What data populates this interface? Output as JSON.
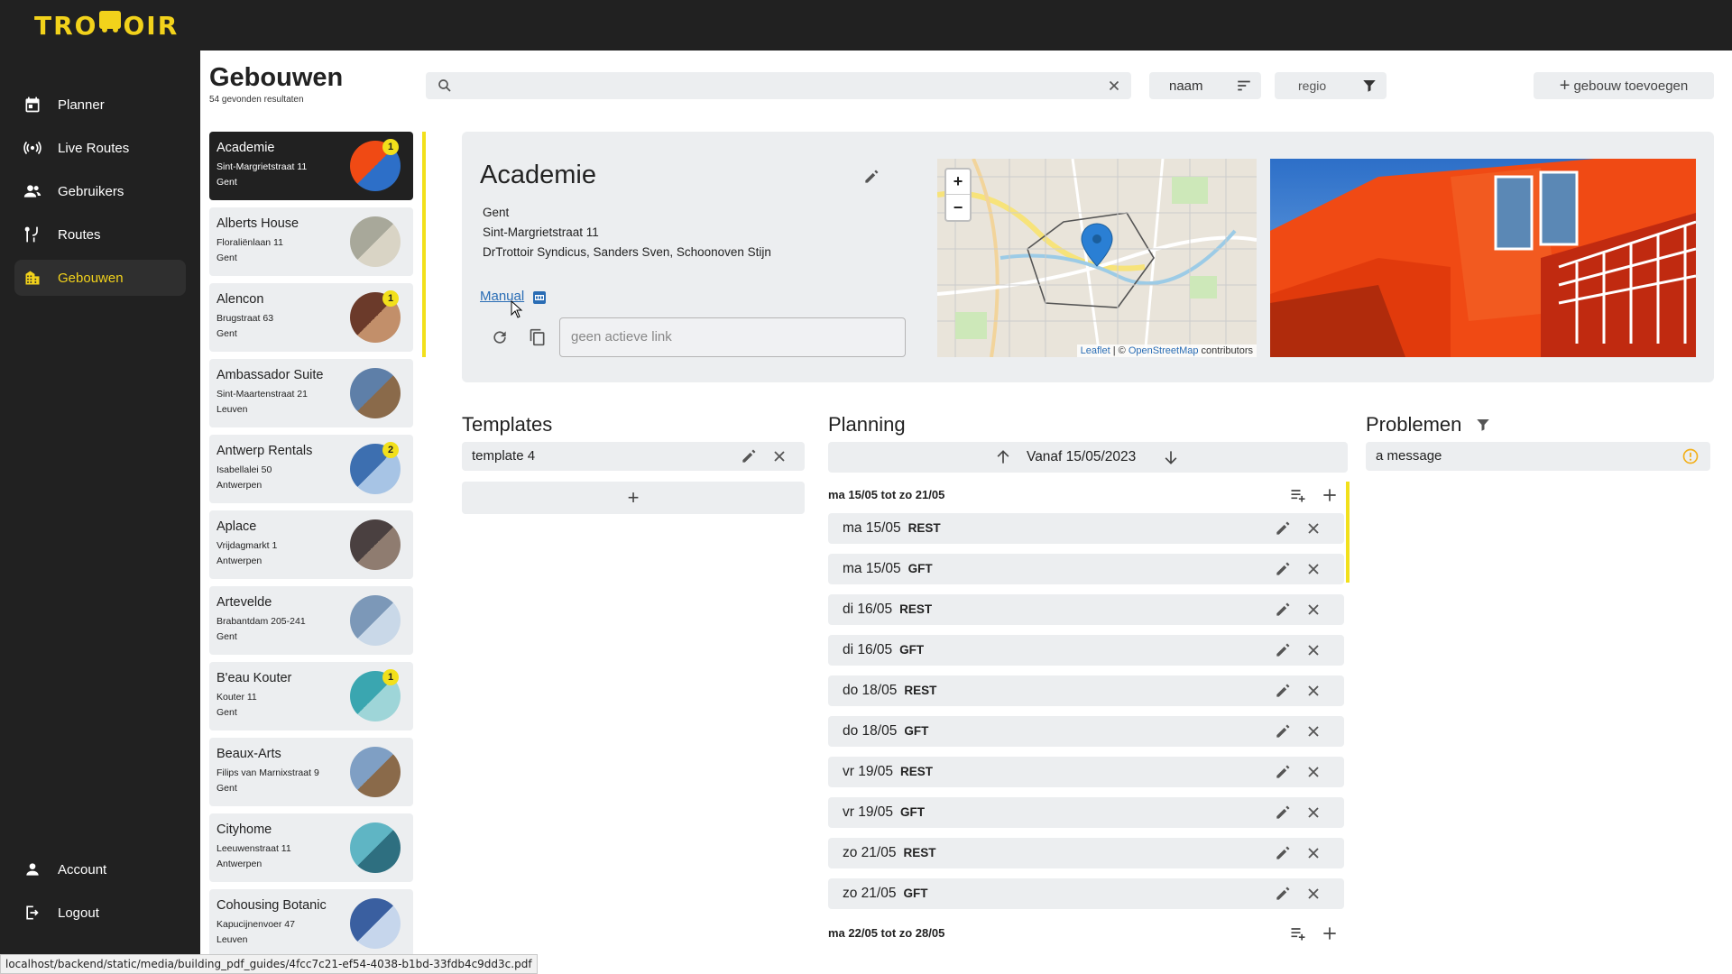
{
  "app": {
    "logo": "TROTTOIR"
  },
  "nav": {
    "items": [
      {
        "label": "Planner",
        "icon": "calendar-icon"
      },
      {
        "label": "Live Routes",
        "icon": "broadcast-icon"
      },
      {
        "label": "Gebruikers",
        "icon": "users-icon"
      },
      {
        "label": "Routes",
        "icon": "route-icon"
      },
      {
        "label": "Gebouwen",
        "icon": "buildings-icon"
      }
    ],
    "account": "Account",
    "logout": "Logout",
    "active_color": "#f2d21b"
  },
  "header": {
    "title": "Gebouwen",
    "count": "54 gevonden resultaten",
    "search": {
      "value": "",
      "placeholder": ""
    },
    "sort_label": "naam",
    "filter_label": "regio",
    "add_label": "gebouw toevoegen"
  },
  "buildings": [
    {
      "name": "Academie",
      "street": "Sint-Margrietstraat 11",
      "city": "Gent",
      "badge": "1"
    },
    {
      "name": "Alberts House",
      "street": "Floraliënlaan 11",
      "city": "Gent",
      "badge": ""
    },
    {
      "name": "Alencon",
      "street": "Brugstraat 63",
      "city": "Gent",
      "badge": "1"
    },
    {
      "name": "Ambassador Suite",
      "street": "Sint-Maartenstraat 21",
      "city": "Leuven",
      "badge": ""
    },
    {
      "name": "Antwerp Rentals",
      "street": "Isabellalei 50",
      "city": "Antwerpen",
      "badge": "2"
    },
    {
      "name": "Aplace",
      "street": "Vrijdagmarkt 1",
      "city": "Antwerpen",
      "badge": ""
    },
    {
      "name": "Artevelde",
      "street": "Brabantdam 205-241",
      "city": "Gent",
      "badge": ""
    },
    {
      "name": "B'eau Kouter",
      "street": "Kouter 11",
      "city": "Gent",
      "badge": "1"
    },
    {
      "name": "Beaux-Arts",
      "street": "Filips van Marnixstraat 9",
      "city": "Gent",
      "badge": ""
    },
    {
      "name": "Cityhome",
      "street": "Leeuwenstraat 11",
      "city": "Antwerpen",
      "badge": ""
    },
    {
      "name": "Cohousing Botanic",
      "street": "Kapucijnenvoer 47",
      "city": "Leuven",
      "badge": ""
    }
  ],
  "detail": {
    "name": "Academie",
    "city": "Gent",
    "street": "Sint-Margrietstraat 11",
    "contacts": "DrTrottoir Syndicus, Sanders Sven, Schoonoven Stijn",
    "manual_label": "Manual",
    "link_placeholder": "geen actieve link",
    "map_attrib_leaflet": "Leaflet",
    "map_attrib_sep": " | © ",
    "map_attrib_osm": "OpenStreetMap",
    "map_attrib_tail": " contributors",
    "zoom_in": "+",
    "zoom_out": "−"
  },
  "templates": {
    "title": "Templates",
    "items": [
      {
        "label": "template 4"
      }
    ],
    "add": "+"
  },
  "planning": {
    "title": "Planning",
    "from_label": "Vanaf 15/05/2023",
    "weeks": [
      {
        "label": "ma 15/05 tot zo 21/05"
      },
      {
        "label": "ma 22/05 tot zo 28/05"
      }
    ],
    "rows": [
      {
        "date": "ma 15/05",
        "type": "REST"
      },
      {
        "date": "ma 15/05",
        "type": "GFT"
      },
      {
        "date": "di 16/05",
        "type": "REST"
      },
      {
        "date": "di 16/05",
        "type": "GFT"
      },
      {
        "date": "do 18/05",
        "type": "REST"
      },
      {
        "date": "do 18/05",
        "type": "GFT"
      },
      {
        "date": "vr 19/05",
        "type": "REST"
      },
      {
        "date": "vr 19/05",
        "type": "GFT"
      },
      {
        "date": "zo 21/05",
        "type": "REST"
      },
      {
        "date": "zo 21/05",
        "type": "GFT"
      }
    ]
  },
  "problems": {
    "title": "Problemen",
    "items": [
      {
        "label": "a message"
      }
    ],
    "warn_color": "#f2b01b"
  },
  "status_url": "localhost/backend/static/media/building_pdf_guides/4fcc7c21-ef54-4038-b1bd-33fdb4c9dd3c.pdf"
}
